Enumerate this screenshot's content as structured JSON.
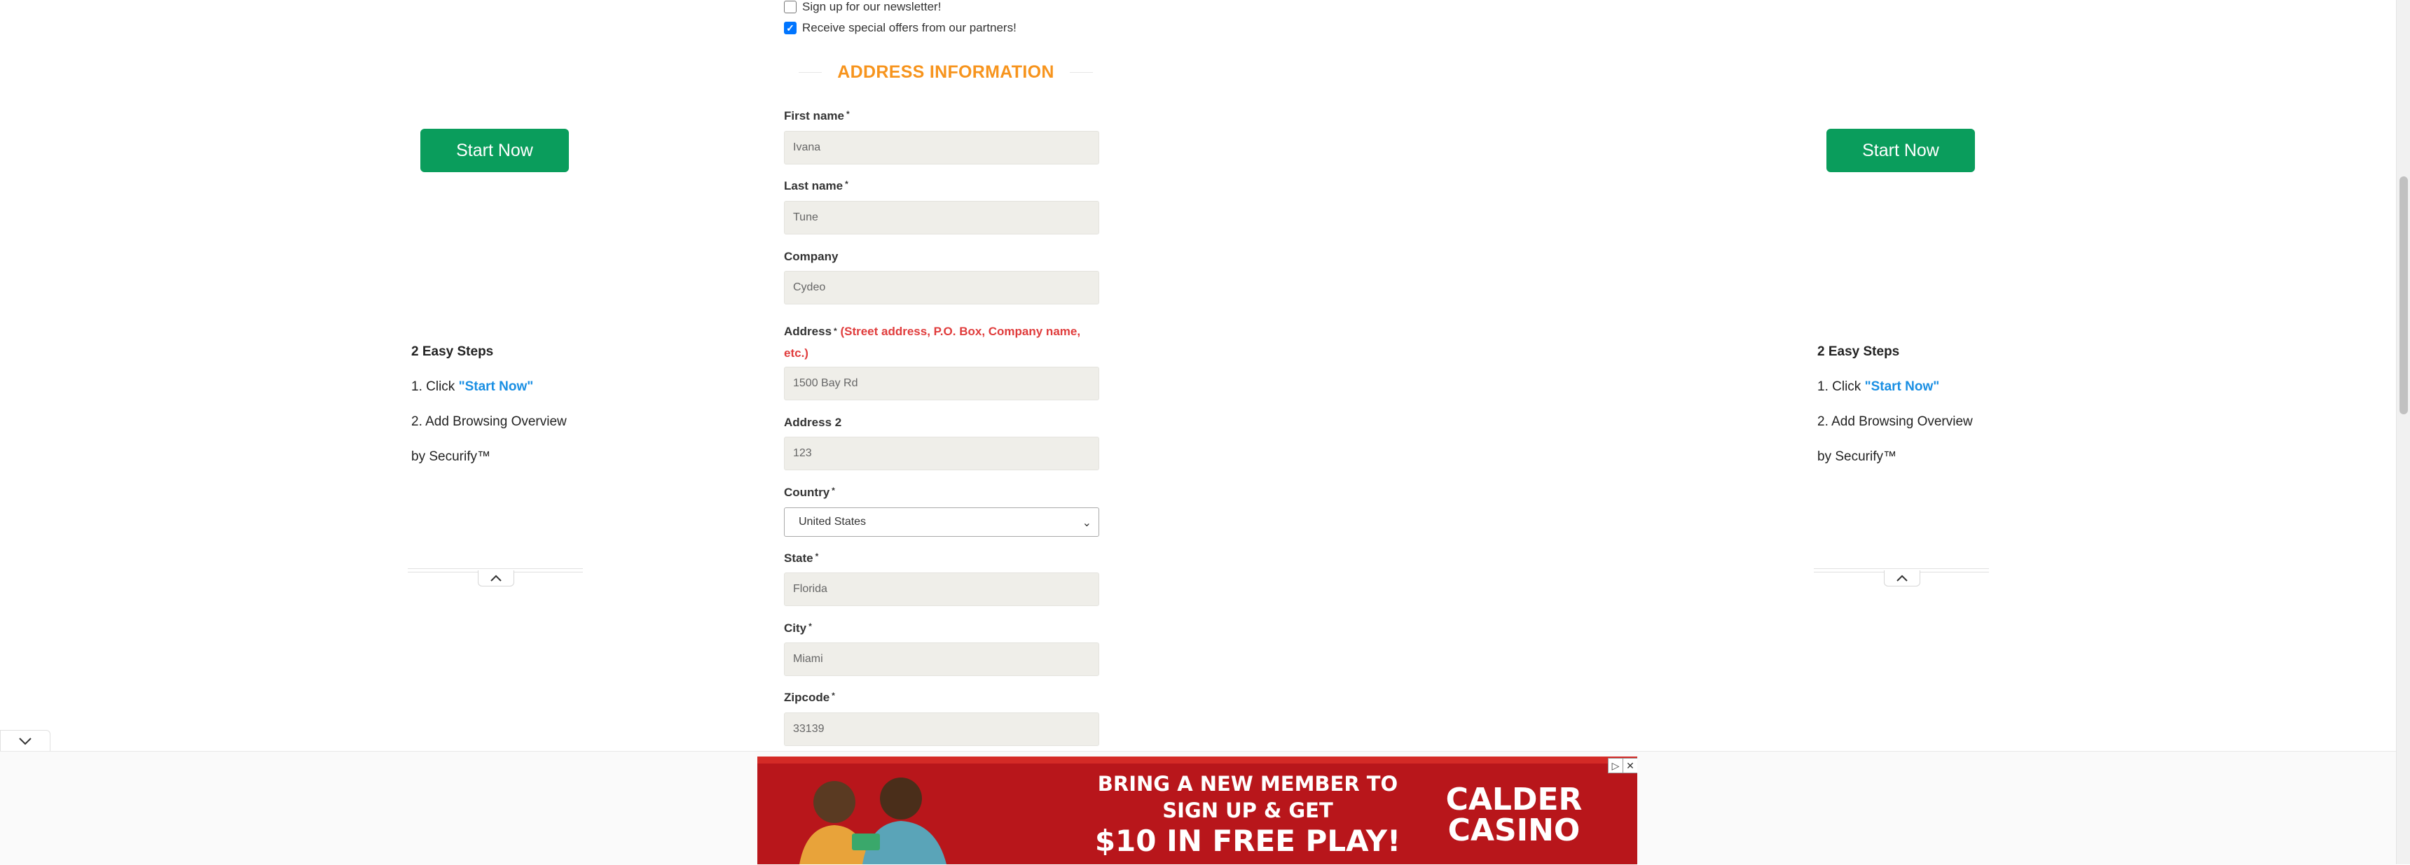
{
  "newsletter": {
    "signup_label": "Sign up for our newsletter!",
    "signup_checked": false,
    "offers_label": "Receive special offers from our partners!",
    "offers_checked": true
  },
  "section": {
    "title": "ADDRESS INFORMATION"
  },
  "form": {
    "required_mark": "*",
    "first_name": {
      "label": "First name",
      "value": "Ivana"
    },
    "last_name": {
      "label": "Last name",
      "value": "Tune"
    },
    "company": {
      "label": "Company",
      "value": "Cydeo"
    },
    "address": {
      "label": "Address",
      "hint": "(Street address, P.O. Box, Company name, etc.)",
      "value": "1500 Bay Rd"
    },
    "address2": {
      "label": "Address 2",
      "value": "123"
    },
    "country": {
      "label": "Country",
      "value": "United States"
    },
    "state": {
      "label": "State",
      "value": "Florida"
    },
    "city": {
      "label": "City",
      "value": "Miami"
    },
    "zipcode": {
      "label": "Zipcode",
      "value": "33139"
    }
  },
  "side": {
    "button_label": "Start Now",
    "heading": "2 Easy Steps",
    "step1_prefix": "1. Click ",
    "step1_link": "\"Start Now\"",
    "step2": "2. Add Browsing Overview",
    "step3": "by Securify™"
  },
  "ad": {
    "line1": "BRING A NEW MEMBER TO",
    "line2": "SIGN UP & GET",
    "line3": "$10 IN FREE PLAY!",
    "brand_line1": "CALDER",
    "brand_line2": "CASINO",
    "colors": {
      "background": "#b8161b",
      "text": "#ffffff"
    }
  },
  "colors": {
    "accent_orange": "#f7941d",
    "start_button": "#0a9d5c",
    "link_blue": "#1a8fe3",
    "hint_red": "#e03c3c",
    "input_bg": "#efeee9"
  }
}
